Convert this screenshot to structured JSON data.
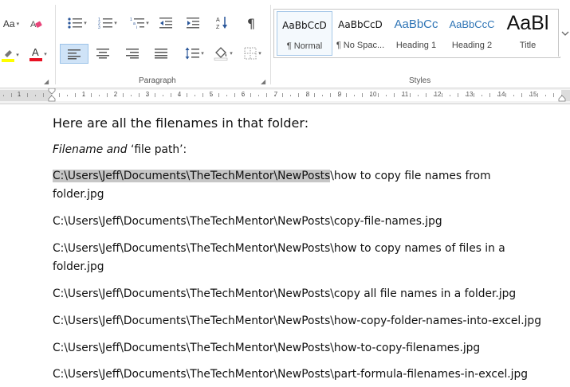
{
  "ribbon": {
    "font_partial": {
      "change_case_label": "Aa",
      "change_case_dropdown": "▾"
    },
    "paragraph_group_label": "Paragraph",
    "styles_group_label": "Styles",
    "styles": [
      {
        "sample": "AaBbCcD",
        "name": "¶ Normal",
        "active": true
      },
      {
        "sample": "AaBbCcD",
        "name": "¶ No Spac...",
        "active": false
      },
      {
        "sample": "AaBbCc",
        "name": "Heading 1",
        "active": false
      },
      {
        "sample": "AaBbCcC",
        "name": "Heading 2",
        "active": false
      },
      {
        "sample": "AaBl",
        "name": "Title",
        "active": false
      }
    ],
    "colors": {
      "highlight": "#ffff00",
      "font_color": "#e81123",
      "accent_selected": "#cfe3f7"
    }
  },
  "ruler": {
    "numbers": [
      "1",
      "1",
      "2",
      "3",
      "4",
      "5",
      "6",
      "7",
      "8",
      "9",
      "10",
      "11",
      "12",
      "13",
      "14",
      "15"
    ]
  },
  "document": {
    "heading": "Here are all the filenames in that folder:",
    "subheading_italic": "Filename and",
    "subheading_rest": " ‘file path’:",
    "selected_path": "C:\\Users\\Jeff\\Documents\\TheTechMentor\\NewPosts",
    "first_line_rest": "how to copy file names from",
    "first_line_wrap": "folder.jpg",
    "lines": [
      "C:\\Users\\Jeff\\Documents\\TheTechMentor\\NewPosts\\copy-file-names.jpg",
      "C:\\Users\\Jeff\\Documents\\TheTechMentor\\NewPosts\\how to copy names of files in a",
      "folder.jpg",
      "C:\\Users\\Jeff\\Documents\\TheTechMentor\\NewPosts\\copy all file names in a folder.jpg",
      "C:\\Users\\Jeff\\Documents\\TheTechMentor\\NewPosts\\how-copy-folder-names-into-excel.jpg",
      "C:\\Users\\Jeff\\Documents\\TheTechMentor\\NewPosts\\how-to-copy-filenames.jpg",
      "C:\\Users\\Jeff\\Documents\\TheTechMentor\\NewPosts\\part-formula-filenames-in-excel.jpg"
    ]
  }
}
